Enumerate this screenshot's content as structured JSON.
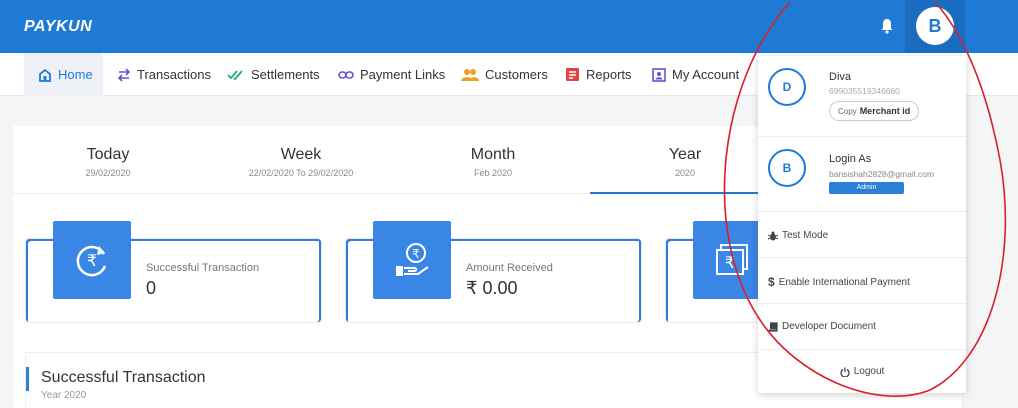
{
  "header": {
    "logo": "PAYKUN",
    "avatar_initial": "B"
  },
  "nav": [
    {
      "label": "Home",
      "icon": "home-icon"
    },
    {
      "label": "Transactions",
      "icon": "transfer-icon"
    },
    {
      "label": "Settlements",
      "icon": "double-check-icon"
    },
    {
      "label": "Payment Links",
      "icon": "link-icon"
    },
    {
      "label": "Customers",
      "icon": "users-icon"
    },
    {
      "label": "Reports",
      "icon": "report-icon"
    },
    {
      "label": "My Account",
      "icon": "account-icon"
    }
  ],
  "tabs": [
    {
      "label": "Today",
      "sub": "29/02/2020"
    },
    {
      "label": "Week",
      "sub": "22/02/2020 To 29/02/2020"
    },
    {
      "label": "Month",
      "sub": "Feb 2020"
    },
    {
      "label": "Year",
      "sub": "2020"
    }
  ],
  "stats": [
    {
      "label": "Successful Transaction",
      "value": "0"
    },
    {
      "label": "Amount Received",
      "value": "₹ 0.00"
    }
  ],
  "section": {
    "title": "Successful Transaction",
    "subtitle": "Year 2020"
  },
  "dropdown": {
    "merchant": {
      "initial": "D",
      "name": "Diva",
      "id": "699035519346660",
      "copy_prefix": "Copy",
      "copy_label": "Merchant id"
    },
    "login": {
      "initial": "B",
      "label": "Login As",
      "email": "bansishah2828@gmail.com",
      "role": "Admin"
    },
    "test_mode": "Test Mode",
    "international": "Enable International Payment",
    "developer": "Developer Document",
    "logout": "Logout"
  },
  "colors": {
    "primary": "#1f7ad6",
    "annotation": "#d9202a"
  }
}
